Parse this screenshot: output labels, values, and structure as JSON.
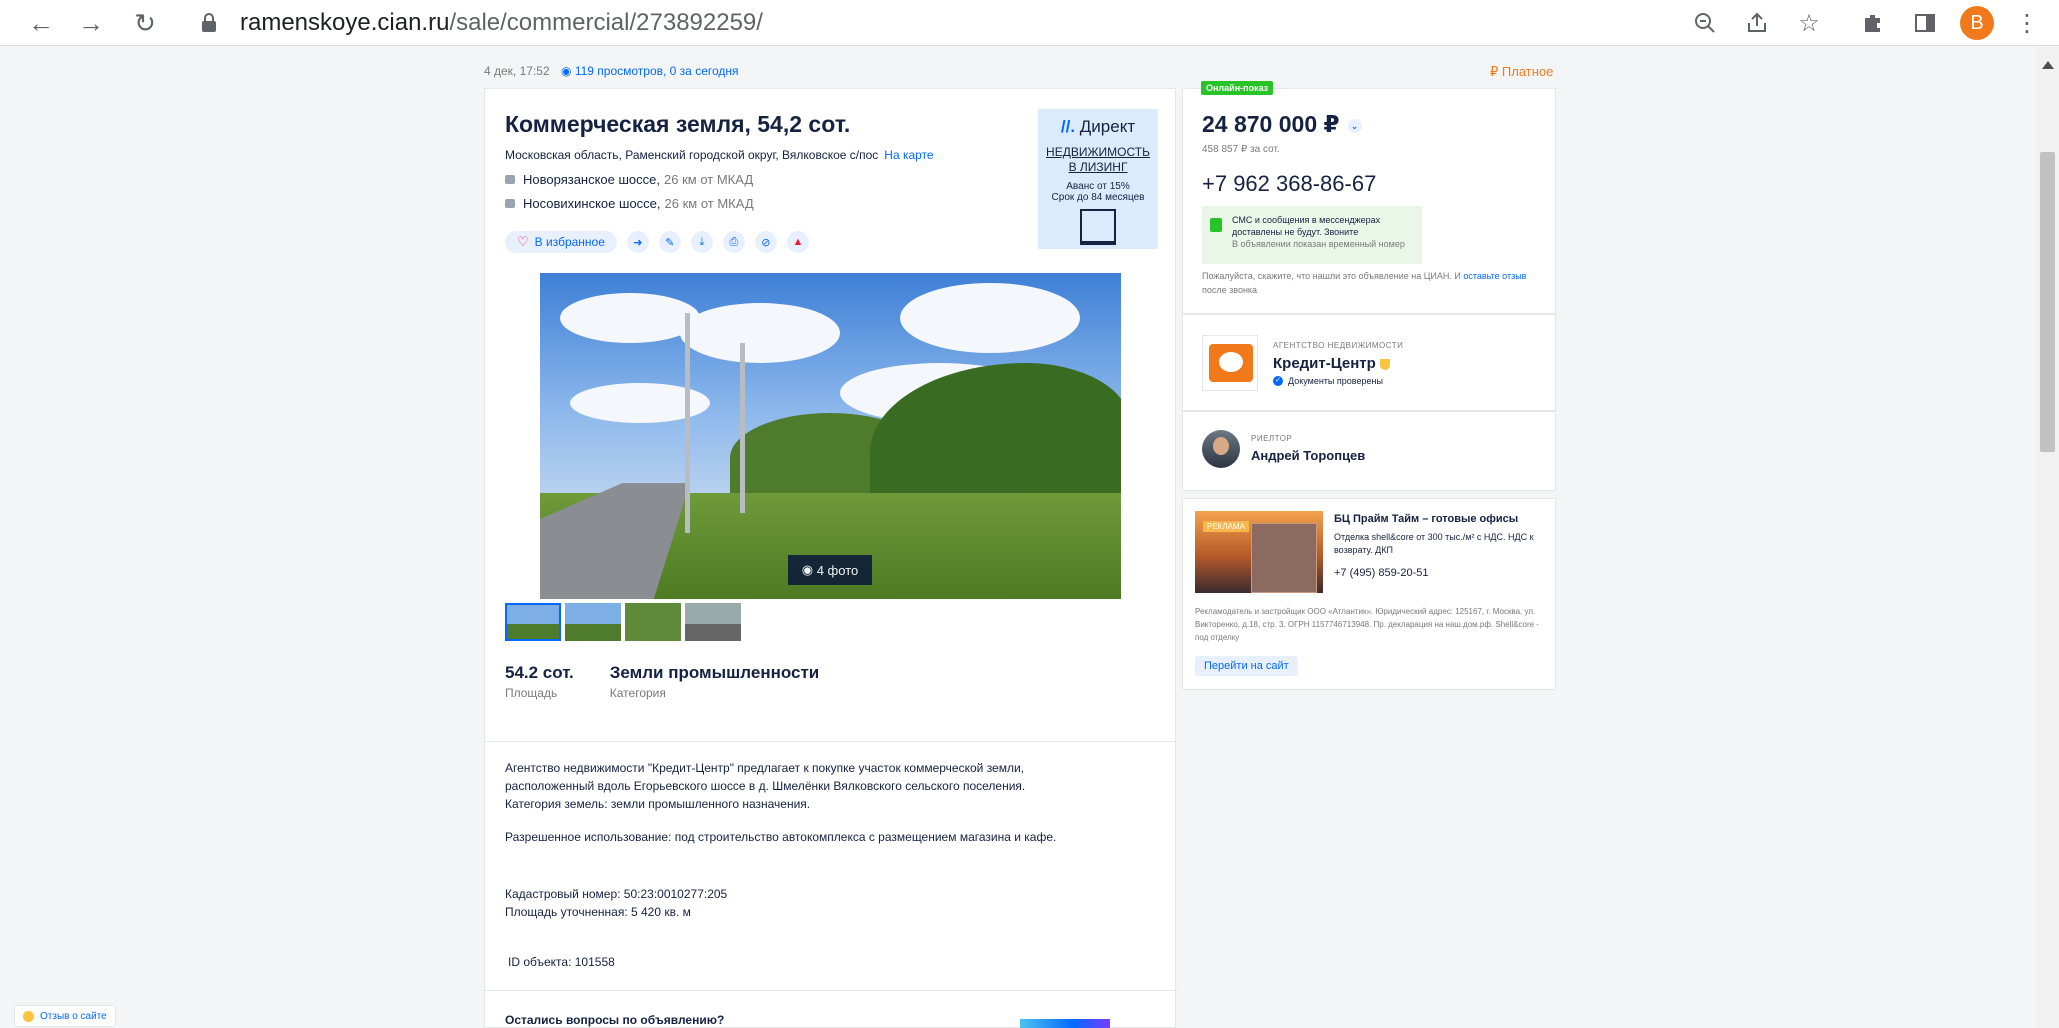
{
  "browser": {
    "url_host": "ramenskoye.cian.ru",
    "url_path": "/sale/commercial/273892259/",
    "profile_initial": "B"
  },
  "meta": {
    "date": "4 дек, 17:52",
    "views": "119 просмотров, 0 за сегодня",
    "paid_label": "Платное"
  },
  "listing": {
    "title": "Коммерческая земля, 54,2 сот.",
    "address": "Московская область, Раменский городской округ, Вялковское с/пос",
    "map_link": "На карте",
    "highways": [
      {
        "name": "Новорязанское шоссе,",
        "distance": "26 км от МКАД"
      },
      {
        "name": "Носовихинское шоссе,",
        "distance": "26 км от МКАД"
      }
    ],
    "favorite_label": "В избранное",
    "photo_count": "4 фото",
    "facts": [
      {
        "value": "54.2 сот.",
        "label": "Площадь"
      },
      {
        "value": "Земли промышленности",
        "label": "Категория"
      }
    ],
    "description": [
      "Агентство недвижимости \"Кредит-Центр\" предлагает к покупке участок коммерческой земли,",
      "расположенный вдоль Егорьевского шоссе в д. Шмелёнки Вялковского сельского поселения.",
      "Категория земель: земли промышленного назначения."
    ],
    "usage": "Разрешенное использование: под строительство автокомплекса с размещением магазина и кафе.",
    "cadastral": "Кадастровый номер: 50:23:0010277:205",
    "area_exact": "Площадь уточненная: 5 420 кв. м",
    "object_id": "ID объекта: 101558",
    "questions": "Остались вопросы по объявлению?"
  },
  "banner": {
    "brand": "Директ",
    "lease_line1": "НЕДВИЖИМОСТЬ",
    "lease_line2": "В ЛИЗИНГ",
    "advance": "Аванс от 15%",
    "term": "Срок до 84 месяцев"
  },
  "price": {
    "online_badge": "Онлайн-показ",
    "amount": "24 870 000 ₽",
    "per_unit": "458 857 ₽ за сот.",
    "phone": "+7 962 368-86-67",
    "sms_line1": "СМС и сообщения в мессенджерах",
    "sms_line2": "доставлены не будут. Звоните",
    "sms_note": "В объявлении показан временный номер",
    "review_text": "Пожалуйста, скажите, что нашли это объявление на ЦИАН. И ",
    "review_link": "оставьте отзыв",
    "review_tail": " после звонка"
  },
  "agency": {
    "type": "АГЕНТСТВО НЕДВИЖИМОСТИ",
    "name": "Кредит-Центр",
    "docs": "Документы проверены"
  },
  "realtor": {
    "type": "РИЕЛТОР",
    "name": "Андрей Торопцев"
  },
  "ad": {
    "tag": "РЕКЛАМА",
    "title": "БЦ Прайм Тайм – готовые офисы",
    "text": "Отделка shell&core от 300 тыс./м² с НДС. НДС к возврату. ДКП",
    "phone": "+7 (495) 859-20-51",
    "legal": "Рекламодатель и застройщик ООО «Атлантик». Юридический адрес: 125167, г. Москва, ул. Викторенко, д.18, стр. 3. ОГРН 1157746713948. Пр. декларация на наш.дом.рф. Shell&core - под отделку",
    "button": "Перейти на сайт"
  },
  "feedback": "Отзыв о сайте"
}
